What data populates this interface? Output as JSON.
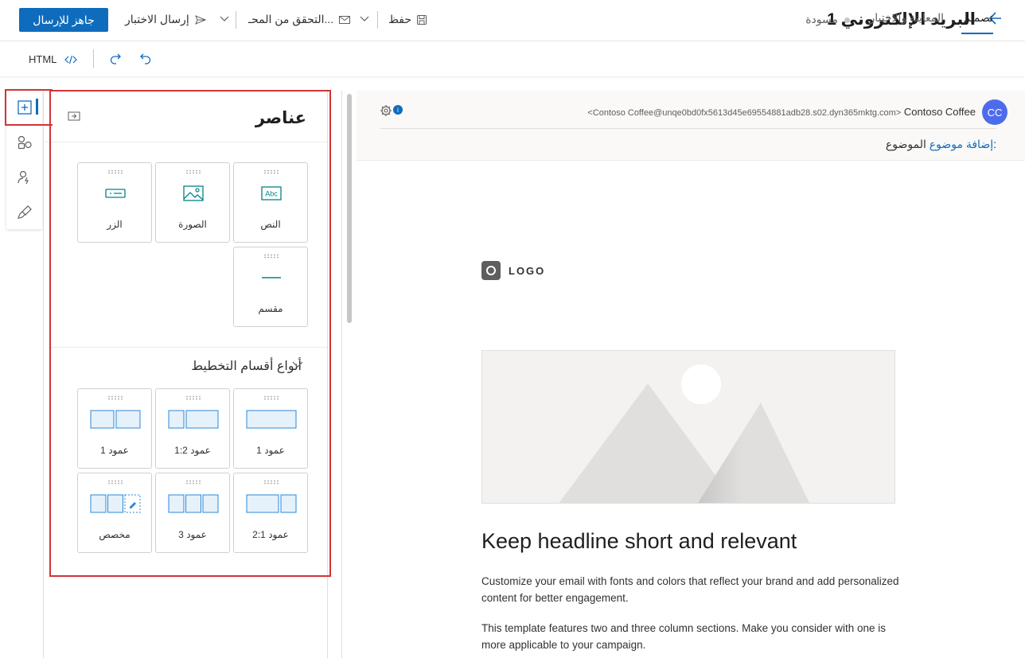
{
  "header": {
    "title": "البريد الإلكتروني 1",
    "status": "مسودة",
    "save_label": "حفظ",
    "check_label": "التحقق من المحـ...",
    "send_test_label": "إرسال الاختبار",
    "ready_label": "جاهز للإرسال"
  },
  "tabs": {
    "design": "تصميم",
    "preview": "المعاينة والاختبار",
    "html_label": "HTML"
  },
  "panel": {
    "title": "عناصر",
    "elements": [
      {
        "label": "النص",
        "icon": "text-icon"
      },
      {
        "label": "الصورة",
        "icon": "image-icon"
      },
      {
        "label": "الزر",
        "icon": "button-icon"
      },
      {
        "label": "مقسم",
        "icon": "divider-icon"
      }
    ],
    "layouts_title": "أنواع أقسام التخطيط",
    "layouts": [
      {
        "label": "1 عمود",
        "icon": "one-column-icon"
      },
      {
        "label": "1:2 عمود",
        "icon": "one-two-column-icon"
      },
      {
        "label": "1 عمود",
        "icon": "two-column-icon"
      },
      {
        "label": "2:1 عمود",
        "icon": "two-one-column-icon"
      },
      {
        "label": "3 عمود",
        "icon": "three-column-icon"
      },
      {
        "label": "مخصص",
        "icon": "custom-column-icon"
      }
    ]
  },
  "email": {
    "avatar": "CC",
    "from_name": "Contoso Coffee",
    "from_address": "<Contoso Coffee@unqe0bd0fx5613d45e69554881adb28.s02.dyn365mktg.com>",
    "subject_label": "الموضوع:",
    "subject_placeholder": "إضافة موضوع",
    "logo_text": "LOGO",
    "headline": "Keep headline short and relevant",
    "paragraph1": "Customize your email with fonts and colors that reflect your brand and add personalized content for better engagement.",
    "paragraph2": "This template features two and three column sections. Make you consider with one is more applicable to your campaign."
  },
  "colors": {
    "accent": "#0f6cbd",
    "highlight": "#d13438",
    "avatar": "#4f6bed"
  }
}
